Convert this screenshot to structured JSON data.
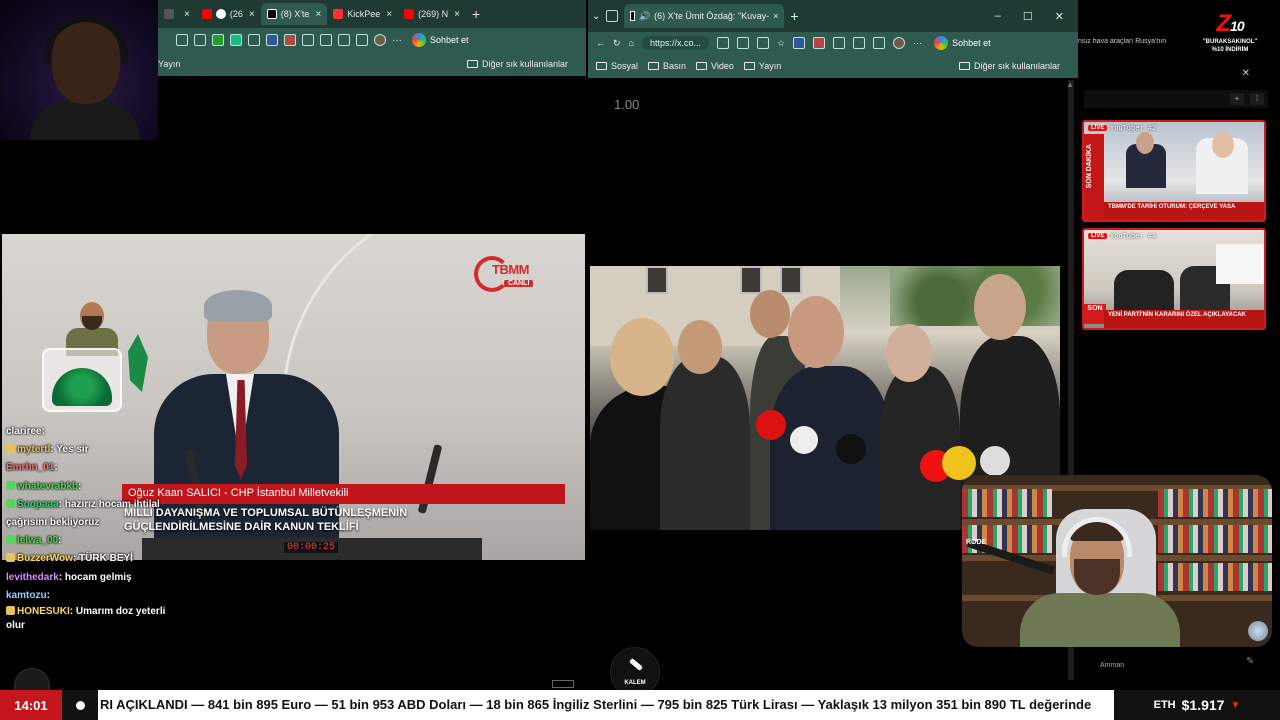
{
  "left_window": {
    "tabs": [
      {
        "label": "",
        "color": "#555"
      },
      {
        "label": "(26",
        "color": "#ff0000"
      },
      {
        "label": "(8) X'te",
        "color": "#000000"
      },
      {
        "label": "KickPee",
        "color": "#ff3030"
      },
      {
        "label": "(269) N",
        "color": "#ff0000"
      }
    ],
    "new_tab": "+",
    "chat_button": "Sohbet et",
    "bookmarks": [
      "Yayın"
    ],
    "other_bookmarks": "Diğer sık kullanılanlar",
    "video": {
      "channel_logo": "TBMM",
      "channel_live": "CANLI",
      "speaker": "Oğuz Kaan SALICI - CHP İstanbul Milletvekili",
      "caption_line1": "MİLLİ DAYANIŞMA VE TOPLUMSAL BÜTÜNLEŞMENİN",
      "caption_line2": "GÜÇLENDİRİLMESİNE DAİR KANUN TEKLİFİ",
      "timer": "00:00:25"
    },
    "chat": [
      {
        "user": "clariree",
        "text": "",
        "user_color": "#ffffff",
        "badge": ""
      },
      {
        "user": "mytertl",
        "text": "Yes sir",
        "user_color": "#e8c25a",
        "badge": "#e8c25a"
      },
      {
        "user": "Emrhn_01",
        "text": "",
        "user_color": "#ff6b6b",
        "badge": ""
      },
      {
        "user": "whatevrabkb",
        "text": "",
        "user_color": "#59d35b",
        "badge": "#59d35b"
      },
      {
        "user": "Soopaaa",
        "text": "hazırız hocam ihtilal çağrısını bekliyoruz",
        "user_color": "#3fd07a",
        "badge": "#59d35b"
      },
      {
        "user": "lelwa_00",
        "text": "",
        "user_color": "#59d35b",
        "badge": "#59d35b"
      },
      {
        "user": "BuzzerWow",
        "text": "TÜRK BEYİ",
        "user_color": "#ffd75a",
        "badge": "#e8c25a"
      },
      {
        "user": "levithedark",
        "text": "hocam gelmiş",
        "user_color": "#d88bff",
        "badge": ""
      },
      {
        "user": "kamtozu",
        "text": "",
        "user_color": "#8ad0ff",
        "badge": ""
      },
      {
        "user": "HONESUKI",
        "text": "Umarım doz yeterli olur",
        "user_color": "#ffd75a",
        "badge": "#e8c25a"
      }
    ]
  },
  "right_window": {
    "tab_title": "(6) X'te Ümit Özdağ: \"Kuvay-",
    "url": "https://x.co...",
    "chat_button": "Sohbet et",
    "bookmarks": [
      "Sosyal",
      "Basın",
      "Video",
      "Yayın"
    ],
    "other_bookmarks": "Diğer sık kullanılanlar",
    "playback_speed": "1.00",
    "pen_label": "KALEM"
  },
  "sidebar": {
    "ticker_snippet": "nsız hava araçları Rusya'nın",
    "brand_main": "Z",
    "brand_sub": "10",
    "brand_line1": "\"BURAKSAKINOL\"",
    "brand_line2": "%10 İNDİRİM",
    "thumbs": [
      {
        "live": "LIVE",
        "label": "YouTube: #2",
        "side": "SON DAKİKA",
        "caption": "TBMM'DE TARİHİ OTURUM: ÇERÇEVE YASA"
      },
      {
        "live": "LIVE",
        "label": "YouTube: #4",
        "side": "SON",
        "caption": "YENİ PARTİ'NİN KARARINI ÖZEL AÇIKLAYACAK"
      }
    ],
    "amman": "Amman"
  },
  "webcam_label": "RØDE",
  "ticker": {
    "time": "14:01",
    "text": "RI AÇIKLANDI — 841 bin 895 Euro — 51 bin 953 ABD Doları — 18 bin 865 İngiliz Sterlini — 795 bin 825 Türk Lirası — Yaklaşık 13 milyon 351 bin 890 TL değerinde",
    "eth_symbol": "ETH",
    "eth_value": "$1.917",
    "eth_trend": "▼"
  }
}
